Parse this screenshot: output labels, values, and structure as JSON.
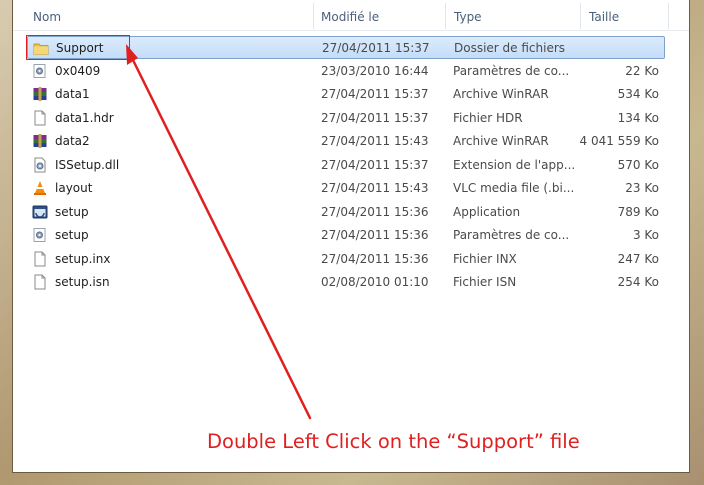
{
  "columns": {
    "name": "Nom",
    "modified": "Modifié le",
    "type": "Type",
    "size": "Taille"
  },
  "files": [
    {
      "name": "Support",
      "modified": "27/04/2011 15:37",
      "type": "Dossier de fichiers",
      "size": "",
      "icon": "folder-icon",
      "selected": true
    },
    {
      "name": "0x0409",
      "modified": "23/03/2010 16:44",
      "type": "Paramètres de co...",
      "size": "22 Ko",
      "icon": "config-settings-icon"
    },
    {
      "name": "data1",
      "modified": "27/04/2011 15:37",
      "type": "Archive WinRAR",
      "size": "534 Ko",
      "icon": "winrar-archive-icon"
    },
    {
      "name": "data1.hdr",
      "modified": "27/04/2011 15:37",
      "type": "Fichier HDR",
      "size": "134 Ko",
      "icon": "blank-file-icon"
    },
    {
      "name": "data2",
      "modified": "27/04/2011 15:43",
      "type": "Archive WinRAR",
      "size": "4 041 559 Ko",
      "icon": "winrar-archive-icon"
    },
    {
      "name": "ISSetup.dll",
      "modified": "27/04/2011 15:37",
      "type": "Extension de l'app...",
      "size": "570 Ko",
      "icon": "dll-file-icon"
    },
    {
      "name": "layout",
      "modified": "27/04/2011 15:43",
      "type": "VLC media file (.bi...",
      "size": "23 Ko",
      "icon": "vlc-cone-icon"
    },
    {
      "name": "setup",
      "modified": "27/04/2011 15:36",
      "type": "Application",
      "size": "789 Ko",
      "icon": "application-icon"
    },
    {
      "name": "setup",
      "modified": "27/04/2011 15:36",
      "type": "Paramètres de co...",
      "size": "3 Ko",
      "icon": "config-settings-icon"
    },
    {
      "name": "setup.inx",
      "modified": "27/04/2011 15:36",
      "type": "Fichier INX",
      "size": "247 Ko",
      "icon": "blank-file-icon"
    },
    {
      "name": "setup.isn",
      "modified": "02/08/2010 01:10",
      "type": "Fichier ISN",
      "size": "254 Ko",
      "icon": "blank-file-icon"
    }
  ],
  "annotation": {
    "text": "Double Left Click on the “Support” file",
    "color": "#e02020"
  }
}
